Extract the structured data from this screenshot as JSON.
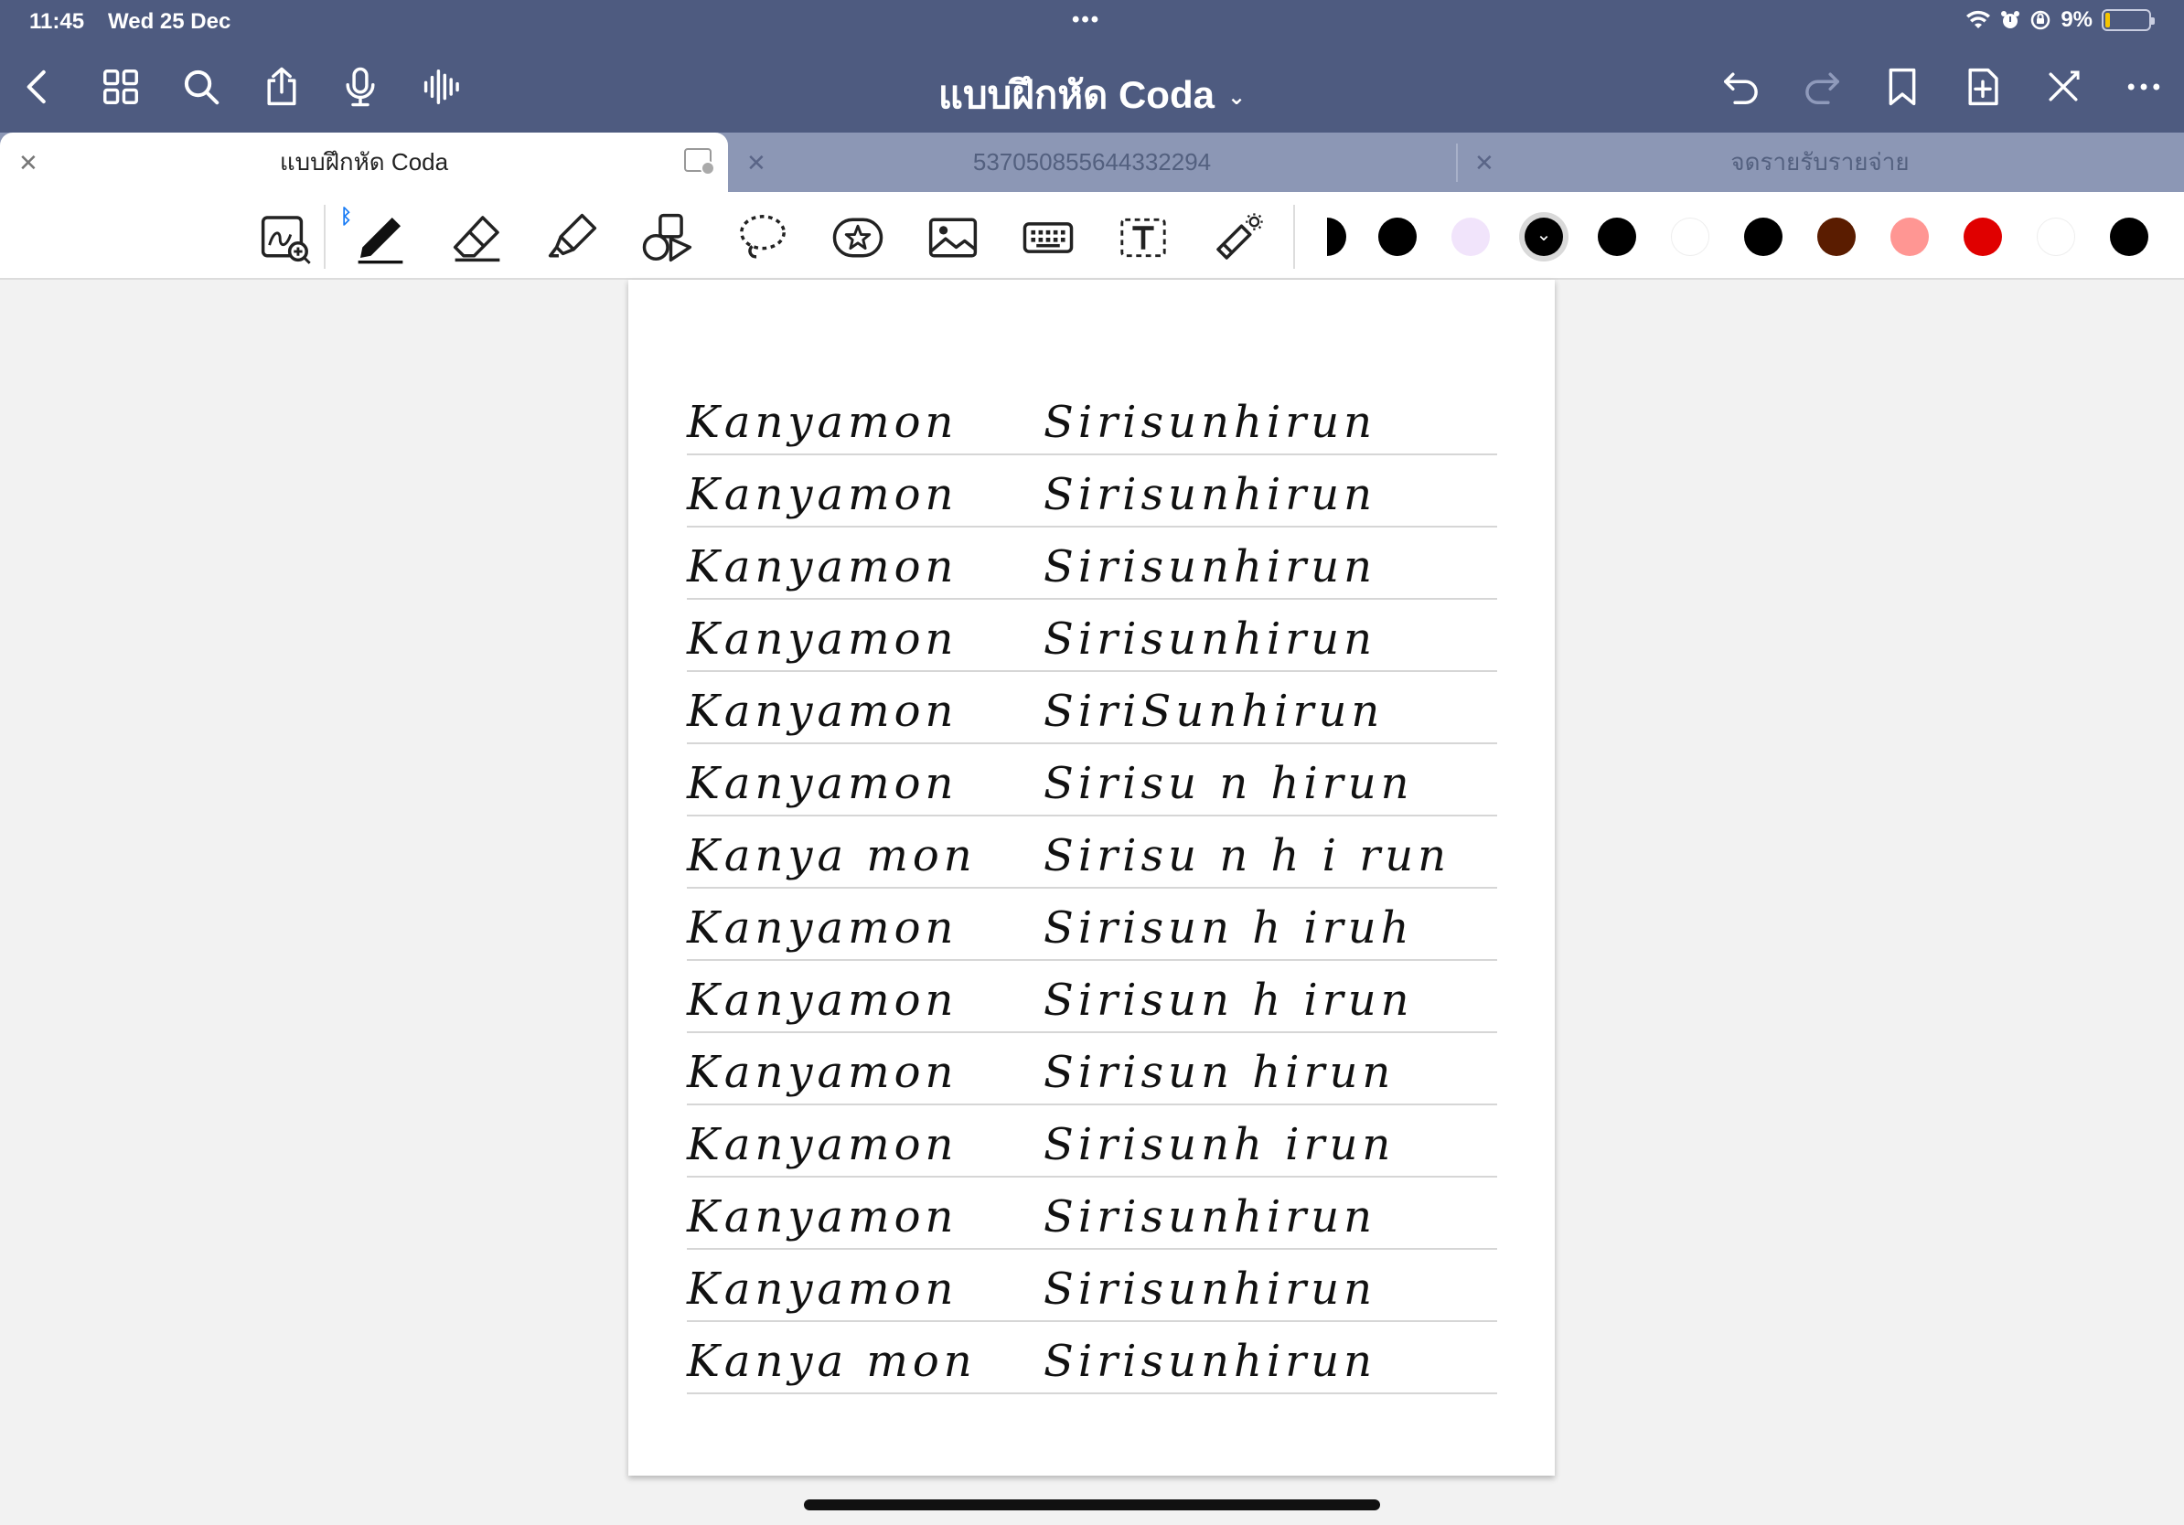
{
  "status": {
    "time": "11:45",
    "date": "Wed 25 Dec",
    "battery": "9%",
    "battery_level": 0.09
  },
  "nav": {
    "title": "แบบฝึกหัด Coda"
  },
  "tabs": [
    {
      "label": "แบบฝึกหัด Coda",
      "active": true
    },
    {
      "label": "537050855644332294",
      "active": false
    },
    {
      "label": "จดรายรับรายจ่าย",
      "active": false
    }
  ],
  "colors": {
    "header": "#4e5b80",
    "tabbar": "#8c97b5",
    "swatches": [
      "#000000",
      "#000000",
      "#f1e4fb",
      "#000000",
      "#000000",
      "#ffffff",
      "#000000",
      "#5a1c00",
      "#ff9693",
      "#e00000",
      "#ffffff",
      "#000000"
    ]
  },
  "page": {
    "rows": [
      {
        "first": "Kanyamon",
        "last": "Sirisunhirun"
      },
      {
        "first": "Kanyamon",
        "last": "Sirisunhirun"
      },
      {
        "first": "Kanyamon",
        "last": "Sirisunhirun"
      },
      {
        "first": "Kanyamon",
        "last": "Sirisunhirun"
      },
      {
        "first": "Kanyamon",
        "last": "SiriSunhirun"
      },
      {
        "first": "Kanyamon",
        "last": "Sirisu n hirun"
      },
      {
        "first": "Kanya mon",
        "last": "Sirisu n h i run"
      },
      {
        "first": "Kanyamon",
        "last": "Sirisun h iruh"
      },
      {
        "first": "Kanyamon",
        "last": "Sirisun h irun"
      },
      {
        "first": "Kanyamon",
        "last": "Sirisun hirun"
      },
      {
        "first": "Kanyamon",
        "last": "Sirisunh irun"
      },
      {
        "first": "Kanyamon",
        "last": "Sirisunhirun"
      },
      {
        "first": "Kanyamon",
        "last": "Sirisunhirun"
      },
      {
        "first": "Kanya mon",
        "last": "Sirisunhirun"
      }
    ]
  }
}
